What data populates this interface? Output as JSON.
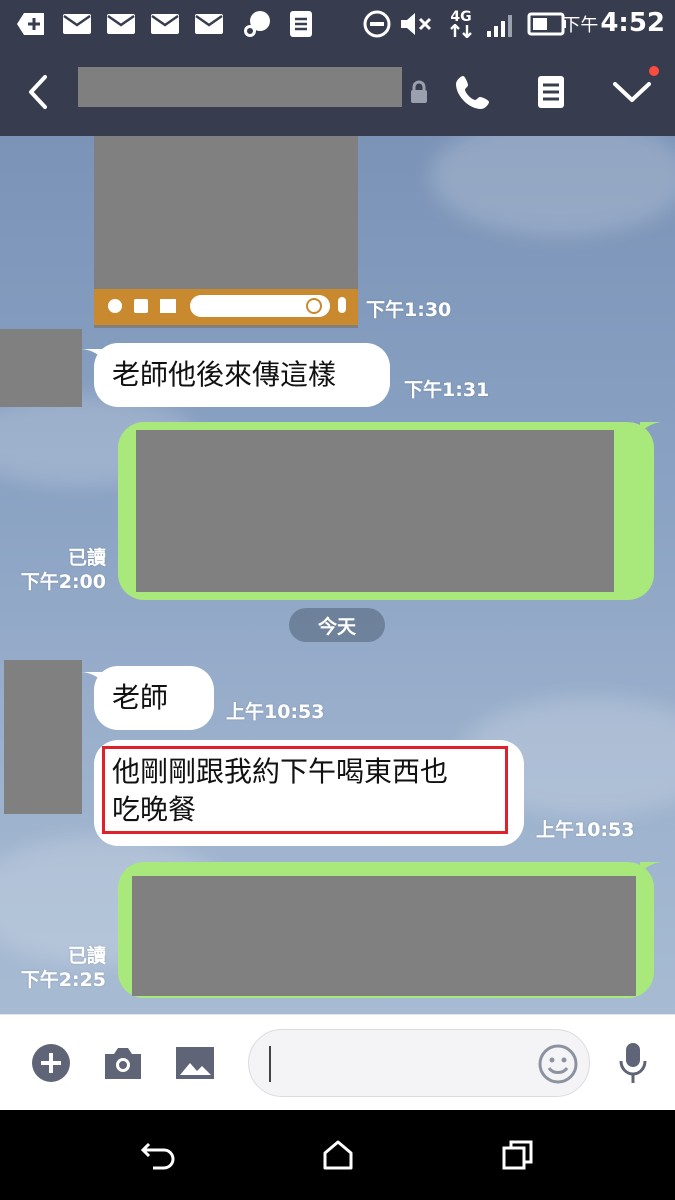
{
  "status_bar": {
    "ampm": "下午",
    "time": "4:52",
    "network": "4G",
    "icons": [
      "plus-notification-icon",
      "mail-icon",
      "mail-icon",
      "mail-icon",
      "mail-icon",
      "chat-bubble-icon",
      "document-icon",
      "do-not-disturb-icon",
      "mute-icon",
      "network-4g-icon",
      "signal-icon",
      "battery-icon"
    ]
  },
  "header": {
    "back_icon": "chevron-left-icon",
    "title": "",
    "lock_icon": "lock-icon",
    "call_icon": "phone-icon",
    "notes_icon": "notes-icon",
    "menu_icon": "chevron-down-icon",
    "notification_dot_color": "#ff4b3e"
  },
  "chat": {
    "background_color": "#8aa2c3",
    "messages": [
      {
        "id": "m1",
        "sender": "other",
        "kind": "image",
        "timestamp": "下午1:30"
      },
      {
        "id": "m2",
        "sender": "other",
        "kind": "text",
        "text": "老師他後來傳這樣",
        "timestamp": "下午1:31"
      },
      {
        "id": "m3",
        "sender": "me",
        "kind": "image",
        "read_label": "已讀",
        "timestamp": "下午2:00"
      },
      {
        "id": "m4",
        "sender": "other",
        "kind": "text",
        "text": "老師",
        "timestamp": "上午10:53"
      },
      {
        "id": "m5",
        "sender": "other",
        "kind": "text",
        "text_line1": "他剛剛跟我約下午喝東西也",
        "text_line2": "吃晚餐",
        "timestamp": "上午10:53",
        "highlight_color": "#e0212c"
      },
      {
        "id": "m6",
        "sender": "me",
        "kind": "image",
        "read_label": "已讀",
        "timestamp": "下午2:25"
      }
    ],
    "date_separator": "今天",
    "outgoing_bubble_color": "#a9e87b",
    "incoming_bubble_color": "#ffffff"
  },
  "input_bar": {
    "plus_icon": "plus-circle-icon",
    "camera_icon": "camera-icon",
    "gallery_icon": "image-icon",
    "placeholder": "",
    "emoji_icon": "smiley-icon",
    "mic_icon": "microphone-icon"
  },
  "nav_bar": {
    "back_icon": "back-arrow-icon",
    "home_icon": "home-icon",
    "recents_icon": "recents-icon"
  }
}
